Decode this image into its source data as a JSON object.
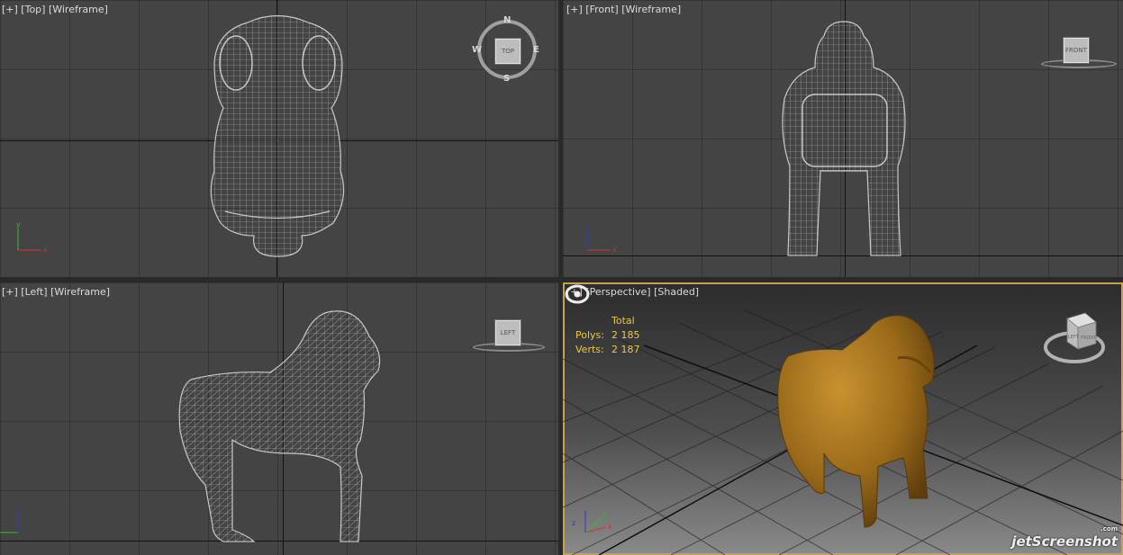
{
  "viewports": {
    "top": {
      "label": "[+] [Top] [Wireframe]",
      "gizmo": {
        "center": "TOP",
        "n": "N",
        "s": "S",
        "e": "E",
        "w": "W"
      }
    },
    "front": {
      "label": "[+] [Front] [Wireframe]",
      "gizmo": {
        "center": "FRONT"
      }
    },
    "left": {
      "label": "[+] [Left] [Wireframe]",
      "gizmo": {
        "center": "LEFT"
      }
    },
    "perspective": {
      "label": "[+] [Perspective] [Shaded]",
      "gizmo": {
        "face_a": "LEFT",
        "face_b": "FRONT"
      }
    }
  },
  "stats": {
    "header": "Total",
    "polys_label": "Polys:",
    "polys_value": "2 185",
    "verts_label": "Verts:",
    "verts_value": "2 187"
  },
  "axes": {
    "x": "x",
    "y": "y",
    "z": "z"
  },
  "watermark": {
    "brand": "jetScreenshot",
    "com": ".com"
  },
  "colors": {
    "accent": "#c6a34a",
    "stats": "#e8c84a",
    "wire": "#bdbdbd",
    "viewport": "#444444",
    "gorilla": "#9a6a1a"
  }
}
